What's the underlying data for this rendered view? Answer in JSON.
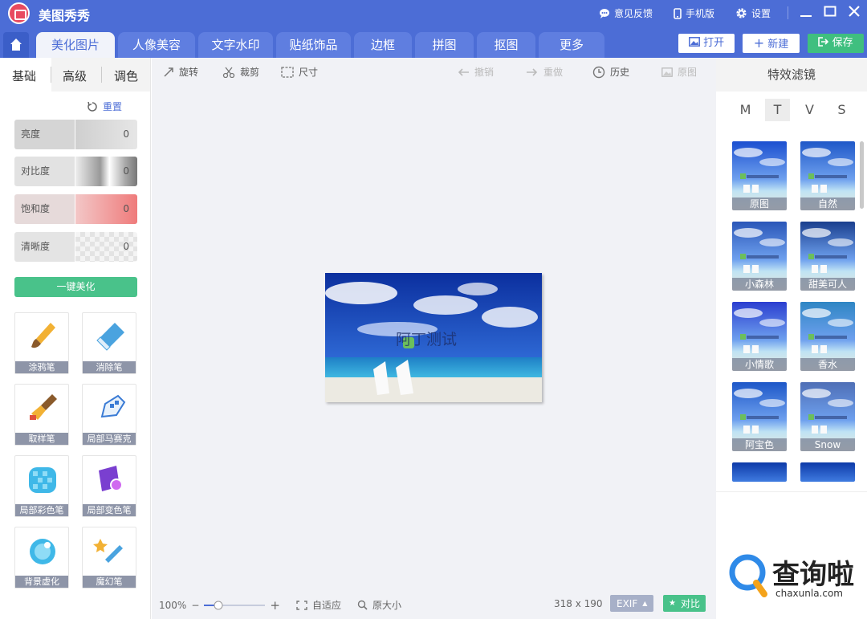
{
  "app": {
    "title": "美图秀秀"
  },
  "titlebar": {
    "feedback": "意见反馈",
    "mobile": "手机版",
    "settings": "设置"
  },
  "tabs": [
    "美化图片",
    "人像美容",
    "文字水印",
    "贴纸饰品",
    "边框",
    "拼图",
    "抠图",
    "更多"
  ],
  "header_buttons": {
    "open": "打开",
    "new": "新建",
    "save": "保存"
  },
  "left": {
    "subtabs": [
      "基础",
      "高级",
      "调色"
    ],
    "reset": "重置",
    "sliders": [
      {
        "label": "亮度",
        "value": "0"
      },
      {
        "label": "对比度",
        "value": "0"
      },
      {
        "label": "饱和度",
        "value": "0"
      },
      {
        "label": "清晰度",
        "value": "0"
      }
    ],
    "one_click": "一键美化",
    "tools": [
      "涂鸦笔",
      "消除笔",
      "取样笔",
      "局部马赛克",
      "局部彩色笔",
      "局部变色笔",
      "背景虚化",
      "魔幻笔"
    ]
  },
  "toolbar": {
    "rotate": "旋转",
    "crop": "裁剪",
    "size": "尺寸",
    "undo": "撤销",
    "redo": "重做",
    "history": "历史",
    "original": "原图"
  },
  "photo": {
    "watermark": "阿丁测试"
  },
  "status": {
    "zoom": "100%",
    "fit": "自适应",
    "actual": "原大小",
    "dims": "318 x 190",
    "exif": "EXIF",
    "compare": "对比"
  },
  "right": {
    "title": "特效滤镜",
    "letters": [
      "M",
      "T",
      "V",
      "S"
    ],
    "filters": [
      "原图",
      "自然",
      "小森林",
      "甜美可人",
      "小情歌",
      "香水",
      "阿宝色",
      "Snow"
    ]
  },
  "watermark_site": {
    "name": "查询啦",
    "url": "chaxunla.com"
  },
  "colors": {
    "brand": "#4c6dd6",
    "green": "#49c28a"
  }
}
